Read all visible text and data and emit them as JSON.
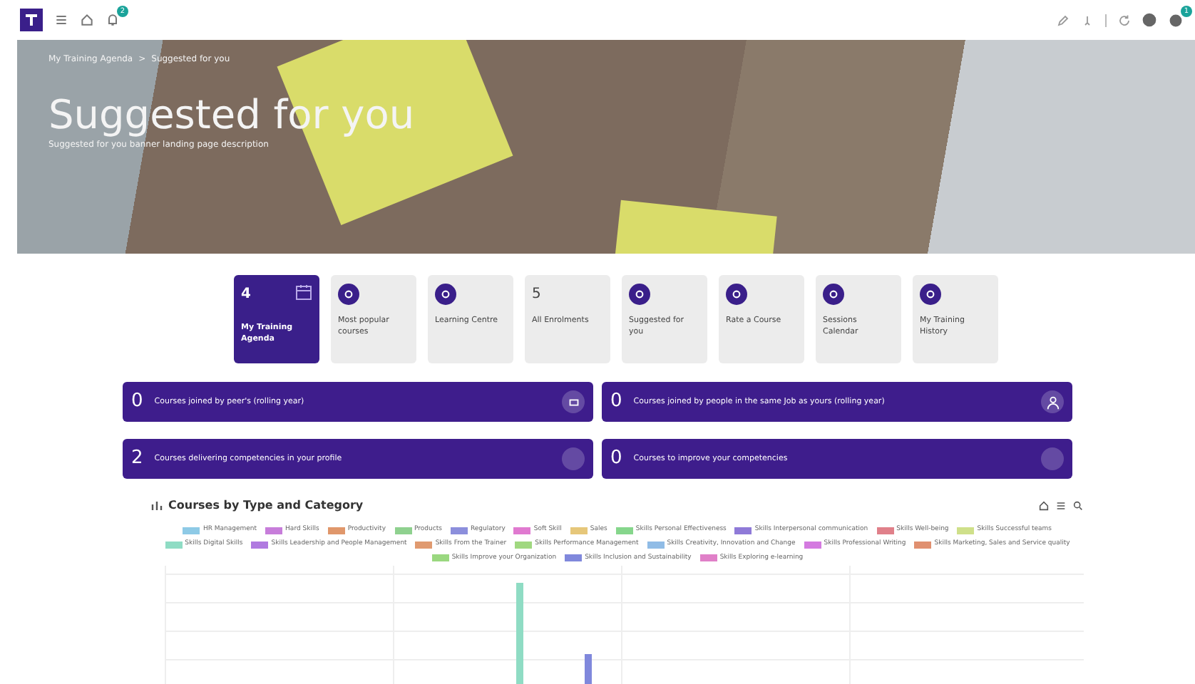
{
  "topbar": {
    "notification_count": "2",
    "settings_count": "1"
  },
  "banner": {
    "breadcrumb": [
      "My Training Agenda",
      "Suggested for you"
    ],
    "breadcrumb_separator": ">",
    "title": "Suggested for you",
    "description": "Suggested for you banner landing page description"
  },
  "tiles": [
    {
      "label": "My Training Agenda",
      "count": "4",
      "selected": true
    },
    {
      "label": "Most popular courses",
      "selected": false
    },
    {
      "label": "Learning Centre",
      "selected": false
    },
    {
      "label": "All Enrolments",
      "count": "5",
      "selected": false
    },
    {
      "label": "Suggested for you",
      "selected": false
    },
    {
      "label": "Rate a Course",
      "selected": false
    },
    {
      "label": "Sessions Calendar",
      "selected": false
    },
    {
      "label": "My Training History",
      "selected": false
    }
  ],
  "stats": [
    {
      "value": "0",
      "label": "Courses joined by peer's (rolling year)"
    },
    {
      "value": "0",
      "label": "Courses joined by people in the same Job as yours (rolling year)"
    },
    {
      "value": "2",
      "label": "Courses delivering competencies in your profile"
    },
    {
      "value": "0",
      "label": "Courses to improve your competencies"
    }
  ],
  "chart": {
    "title": "Courses by Type and Category",
    "legend": [
      {
        "label": "HR Management",
        "color": "#8ecae6"
      },
      {
        "label": "Hard Skills",
        "color": "#c77dda"
      },
      {
        "label": "Productivity",
        "color": "#e0976b"
      },
      {
        "label": "Products",
        "color": "#8fd18f"
      },
      {
        "label": "Regulatory",
        "color": "#8c8fdc"
      },
      {
        "label": "Soft Skill",
        "color": "#e07ad0"
      },
      {
        "label": "Sales",
        "color": "#e6c77a"
      },
      {
        "label": "Skills Personal Effectiveness",
        "color": "#86d68c"
      },
      {
        "label": "Skills Interpersonal communication",
        "color": "#8f7ad8"
      },
      {
        "label": "Skills Well-being",
        "color": "#e0808a"
      },
      {
        "label": "Skills Successful teams",
        "color": "#cfe08a"
      },
      {
        "label": "Skills Digital Skills",
        "color": "#8fdcc4"
      },
      {
        "label": "Skills Leadership and People Management",
        "color": "#b07ae0"
      },
      {
        "label": "Skills From the Trainer",
        "color": "#e09a70"
      },
      {
        "label": "Skills Performance Management",
        "color": "#a0d880"
      },
      {
        "label": "Skills Creativity, Innovation and Change",
        "color": "#90bce6"
      },
      {
        "label": "Skills Professional Writing",
        "color": "#d47ae0"
      },
      {
        "label": "Skills Marketing, Sales and Service quality",
        "color": "#e09070"
      },
      {
        "label": "Skills Improve your Organization",
        "color": "#9ad880"
      },
      {
        "label": "Skills Inclusion and Sustainability",
        "color": "#8088dc"
      },
      {
        "label": "Skills Exploring e-learning",
        "color": "#e080c8"
      }
    ]
  }
}
